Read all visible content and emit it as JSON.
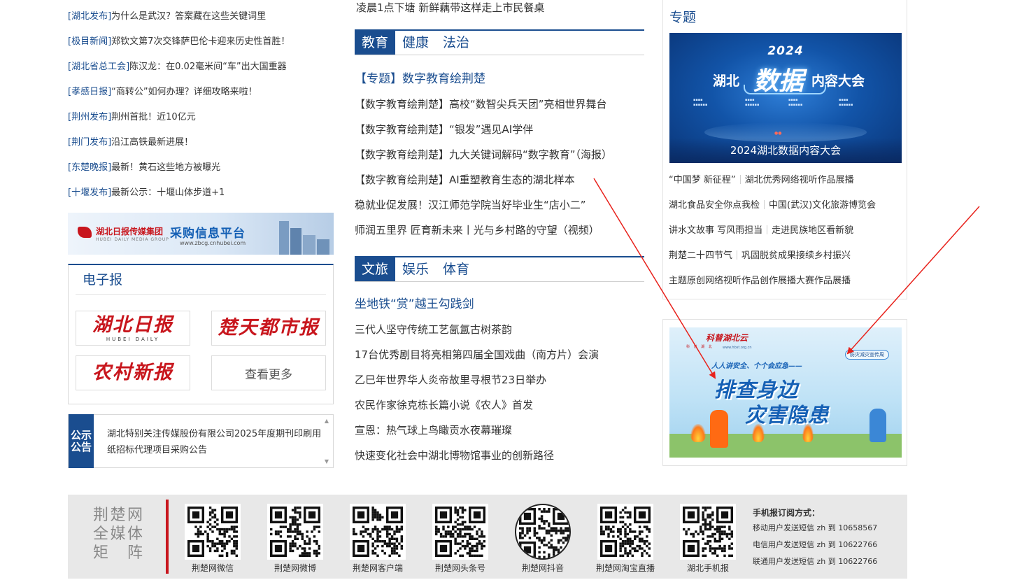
{
  "left_news": [
    {
      "source": "[湖北发布]",
      "title": "为什么是武汉？答案藏在这些关键词里"
    },
    {
      "source": "[极目新闻]",
      "title": "郑钦文第7次交锋萨巴伦卡迎来历史性首胜！"
    },
    {
      "source": "[湖北省总工会]",
      "title": "陈汉龙：在0.02毫米间“车”出大国重器"
    },
    {
      "source": "[孝感日报]",
      "title": "“商转公”如何办理？详细攻略来啦！"
    },
    {
      "source": "[荆州发布]",
      "title": "荆州首批！近10亿元"
    },
    {
      "source": "[荆门发布]",
      "title": "沿江高铁最新进展！"
    },
    {
      "source": "[东楚晚报]",
      "title": "最新！黄石这些地方被曝光"
    },
    {
      "source": "[十堰发布]",
      "title": "最新公示：十堰山体步道+1"
    }
  ],
  "zbcg_banner": {
    "brand": "湖北日报传媒集团",
    "brand_en": "HUBEI DAILY MEDIA GROUP",
    "title": "采购信息平台",
    "url": "www.zbcg.cnhubei.com"
  },
  "epaper": {
    "title": "电子报",
    "papers": [
      {
        "name": "湖北日报",
        "sub": "HUBEI DAILY"
      },
      {
        "name": "楚天都市报"
      },
      {
        "name": "农村新报"
      }
    ],
    "more": "查看更多"
  },
  "notice": {
    "tag": [
      "公示",
      "公告"
    ],
    "text": "湖北特别关注传媒股份有限公司2025年度期刊印刷用纸招标代理项目采购公告"
  },
  "mid_top": "凌晨1点下塘 新鲜藕带这样走上市民餐桌",
  "section_education": {
    "tabs": [
      "教育",
      "健康",
      "法治"
    ],
    "items": [
      "【专题】数字教育绘荆楚",
      "【数字教育绘荆楚】高校“数智尖兵天团”亮相世界舞台",
      "【数字教育绘荆楚】“银发”遇见AI学伴",
      "【数字教育绘荆楚】九大关键词解码“数字教育”（海报）",
      "【数字教育绘荆楚】AI重塑教育生态的湖北样本",
      "稳就业促发展！汉江师范学院当好毕业生“店小二”",
      "师润五里界 匠育新未来丨光与乡村路的守望（视频）"
    ]
  },
  "section_culture": {
    "tabs": [
      "文旅",
      "娱乐",
      "体育"
    ],
    "items": [
      "坐地铁“赏”越王勾践剑",
      "三代人坚守传统工艺氤氲古树茶韵",
      "17台优秀剧目将亮相第四届全国戏曲（南方片）会演",
      "乙巳年世界华人炎帝故里寻根节23日举办",
      "农民作家徐克栋长篇小说《农人》首发",
      "宣恩：热气球上鸟瞰贡水夜幕璀璨",
      "快速变化社会中湖北博物馆事业的创新路径"
    ]
  },
  "topics": {
    "title": "专题",
    "banner": {
      "year": "2024",
      "left": "湖北",
      "big": "数据",
      "right": "内容大会",
      "caption": "2024湖北数据内容大会"
    },
    "links": [
      [
        "“中国梦 新征程”",
        "湖北优秀网络视听作品展播"
      ],
      [
        "湖北食品安全你点我检",
        "中国(武汉)文化旅游博览会"
      ],
      [
        "讲水文故事 写风雨担当",
        "走进民族地区看新貌"
      ],
      [
        "荆楚二十四节气",
        "巩固脱贫成果接续乡村振兴"
      ],
      [
        "主题原创网络视听作品创作展播大赛作品展播"
      ]
    ]
  },
  "disaster_banner": {
    "logo": "科普湖北云",
    "logo_sub": "科 普 湖 北",
    "url": "www.hbst.org.cn",
    "badge": "防灾减灾宣传周",
    "slogan": "人人讲安全、个个会应急——",
    "line1": "排查身边",
    "line2": "灾害隐患"
  },
  "footer": {
    "brand": [
      "荆楚网",
      "全媒体",
      "矩　阵"
    ],
    "qrcodes": [
      {
        "label": "荆楚网微信"
      },
      {
        "label": "荆楚网微博"
      },
      {
        "label": "荆楚网客户端"
      },
      {
        "label": "荆楚网头条号"
      },
      {
        "label": "荆楚网抖音"
      },
      {
        "label": "荆楚网淘宝直播"
      },
      {
        "label": "湖北手机报"
      }
    ],
    "subscribe": {
      "title": "手机报订阅方式：",
      "lines": [
        "移动用户发送短信 zh 到 10658567",
        "电信用户发送短信 zh 到 10622766",
        "联通用户发送短信 zh 到 10622766"
      ]
    }
  },
  "colors": {
    "brand_blue": "#1a4d8f",
    "brand_red": "#c8161d",
    "arrow_red": "#e8221c"
  }
}
